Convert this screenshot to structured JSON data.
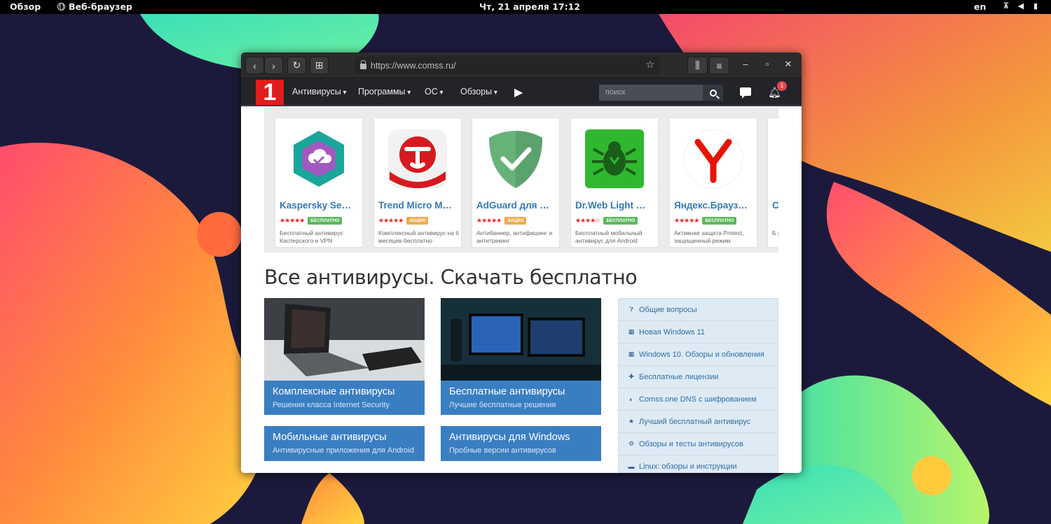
{
  "topbar": {
    "overview": "Обзор",
    "app_name": "Веб-браузер",
    "clock": "Чт, 21 апреля 17:12",
    "lang": "en",
    "status_icons": [
      "network-icon",
      "volume-icon",
      "battery-icon"
    ]
  },
  "browser": {
    "url": "https://www.comss.ru/",
    "controls": [
      "back-icon",
      "forward-icon",
      "reload-icon",
      "new-tab-icon",
      "library-icon",
      "menu-icon",
      "minimize-icon",
      "maximize-icon",
      "close-icon"
    ]
  },
  "site": {
    "logo_text": "1",
    "nav": [
      "Антивирусы",
      "Программы",
      "ОС",
      "Обзоры"
    ],
    "search_placeholder": "поиск",
    "notifications": "1"
  },
  "cards": [
    {
      "name": "Kaspersky Se…",
      "stars": "★★★★★",
      "tag": "БЕСПЛАТНО",
      "tag_color": "#5cb85c",
      "desc": "Бесплатный антивирус Касперского и VPN"
    },
    {
      "name": "Trend Micro M…",
      "stars": "★★★★★",
      "tag": "АКЦИЯ",
      "tag_color": "#f0ad4e",
      "desc": "Комплексный антивирус на 6 месяцев бесплатно"
    },
    {
      "name": "AdGuard для …",
      "stars": "★★★★★",
      "tag": "АКЦИЯ",
      "tag_color": "#f0ad4e",
      "desc": "Антибаннер, антифишинг и антитрекинг"
    },
    {
      "name": "Dr.Web Light …",
      "stars": "★★★★☆",
      "tag": "БЕСПЛАТНО",
      "tag_color": "#5cb85c",
      "desc": "Бесплатный мобильный антивирус для Android"
    },
    {
      "name": "Яндекс.Брауз…",
      "stars": "★★★★★",
      "tag": "БЕСПЛАТНО",
      "tag_color": "#5cb85c",
      "desc": "Активная защита Protect, защищенный режим"
    },
    {
      "name": "C",
      "stars": "",
      "tag": "",
      "tag_color": "#5cb85c",
      "desc": "Б ре"
    }
  ],
  "heading": "Все антивирусы. Скачать бесплатно",
  "tiles": [
    {
      "title": "Комплексные антивирусы",
      "sub": "Решения класса Internet Security"
    },
    {
      "title": "Бесплатные антивирусы",
      "sub": "Лучшие бесплатные решения"
    },
    {
      "title": "Мобильные антивирусы",
      "sub": "Антивирусные приложения для Android"
    },
    {
      "title": "Антивирусы для Windows",
      "sub": "Пробные версии антивирусов"
    }
  ],
  "sidebar": [
    {
      "icon": "question-icon",
      "label": "Общие вопросы"
    },
    {
      "icon": "windows-icon",
      "label": "Новая Windows 11"
    },
    {
      "icon": "windows-icon",
      "label": "Windows 10. Обзоры и обновления"
    },
    {
      "icon": "gift-icon",
      "label": "Бесплатные лицензии"
    },
    {
      "icon": "dns-icon",
      "label": "Comss.one DNS с шифрованием"
    },
    {
      "icon": "star-icon",
      "label": "Лучший бесплатный антивирус"
    },
    {
      "icon": "shield-icon",
      "label": "Обзоры и тесты антивирусов"
    },
    {
      "icon": "linux-icon",
      "label": "Linux: обзоры и инструкции"
    }
  ]
}
